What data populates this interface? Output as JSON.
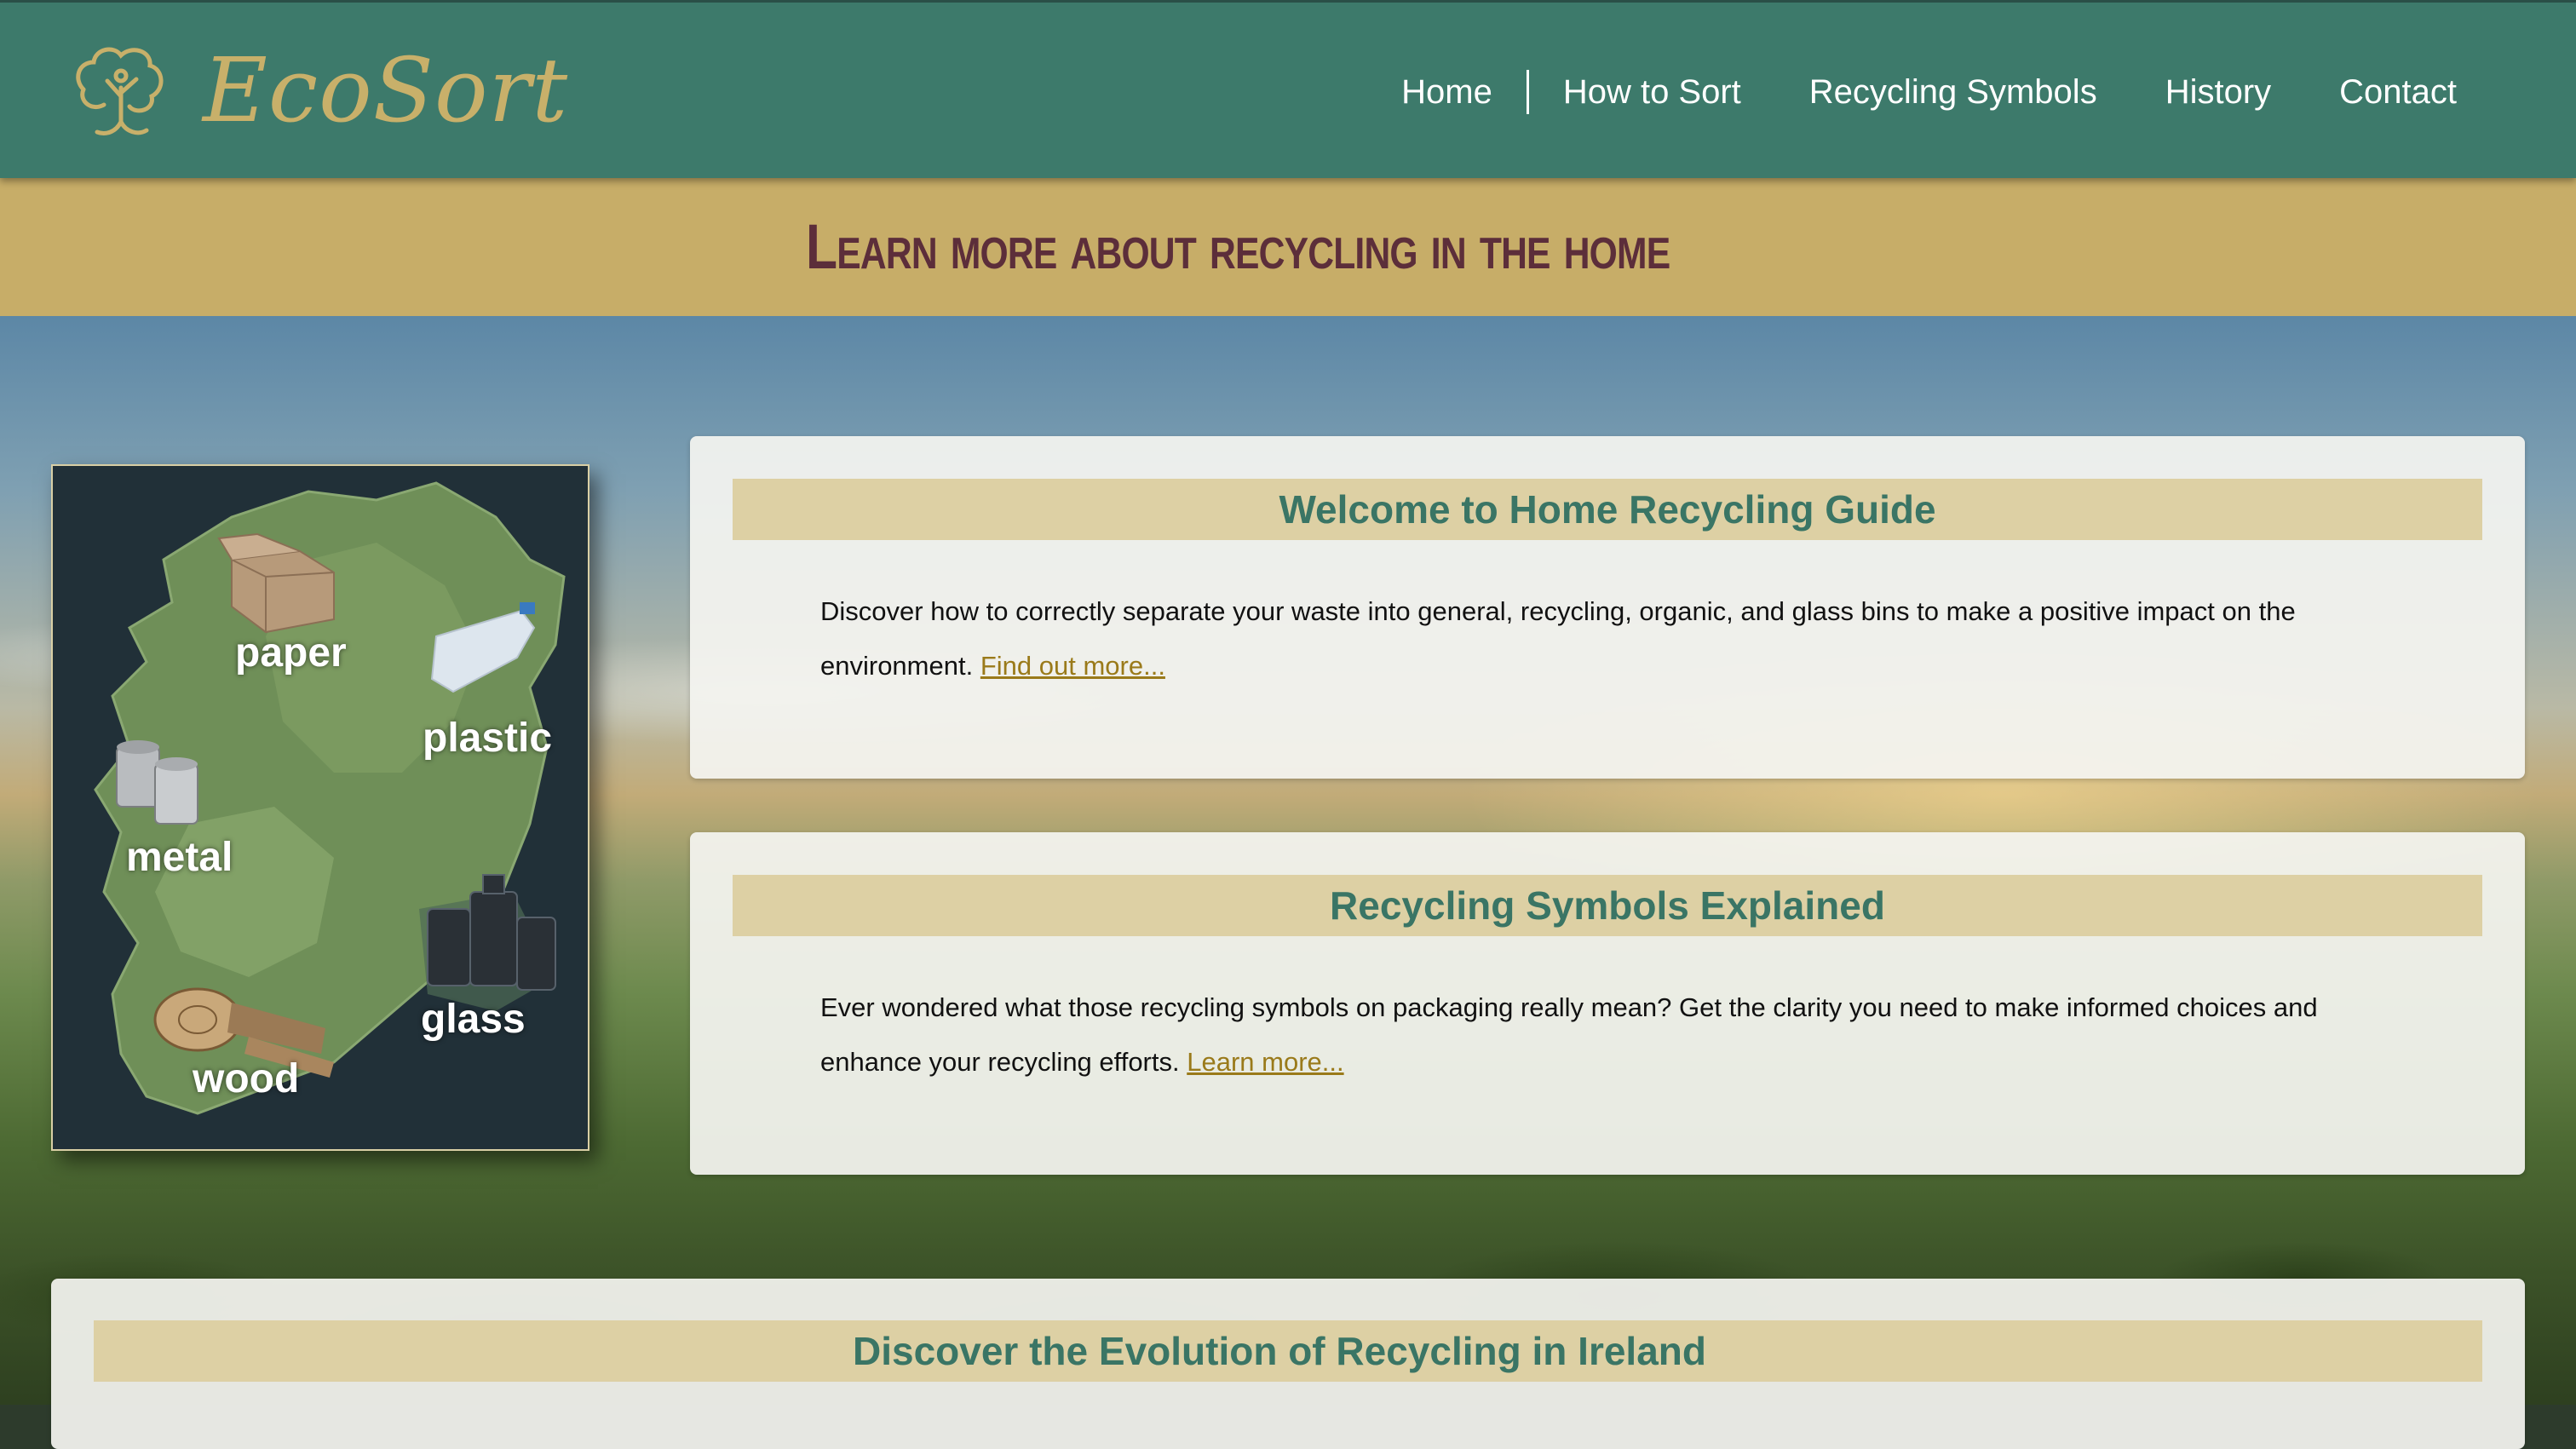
{
  "brand": "EcoSort",
  "nav": {
    "items": [
      "Home",
      "How to Sort",
      "Recycling Symbols",
      "History",
      "Contact"
    ]
  },
  "banner": {
    "heading": "Learn more about recycling in the home"
  },
  "map": {
    "labels": [
      "paper",
      "plastic",
      "metal",
      "glass",
      "wood"
    ]
  },
  "cards": [
    {
      "title": "Welcome to Home Recycling Guide",
      "text": "Discover how to correctly separate your waste into general, recycling, organic, and glass bins to make a positive impact on the environment.",
      "link": "Find out more..."
    },
    {
      "title": "Recycling Symbols Explained",
      "text": "Ever wondered what those recycling symbols on packaging really mean? Get the clarity you need to make informed choices and enhance your recycling efforts.",
      "link": "Learn more..."
    },
    {
      "title": "Discover the Evolution of Recycling in Ireland"
    }
  ],
  "colors": {
    "header": "#3d7a6b",
    "banner": "#c7ad68",
    "heading": "#5c2e3a",
    "card_title": "#3a7565",
    "link": "#9a7a1a"
  }
}
